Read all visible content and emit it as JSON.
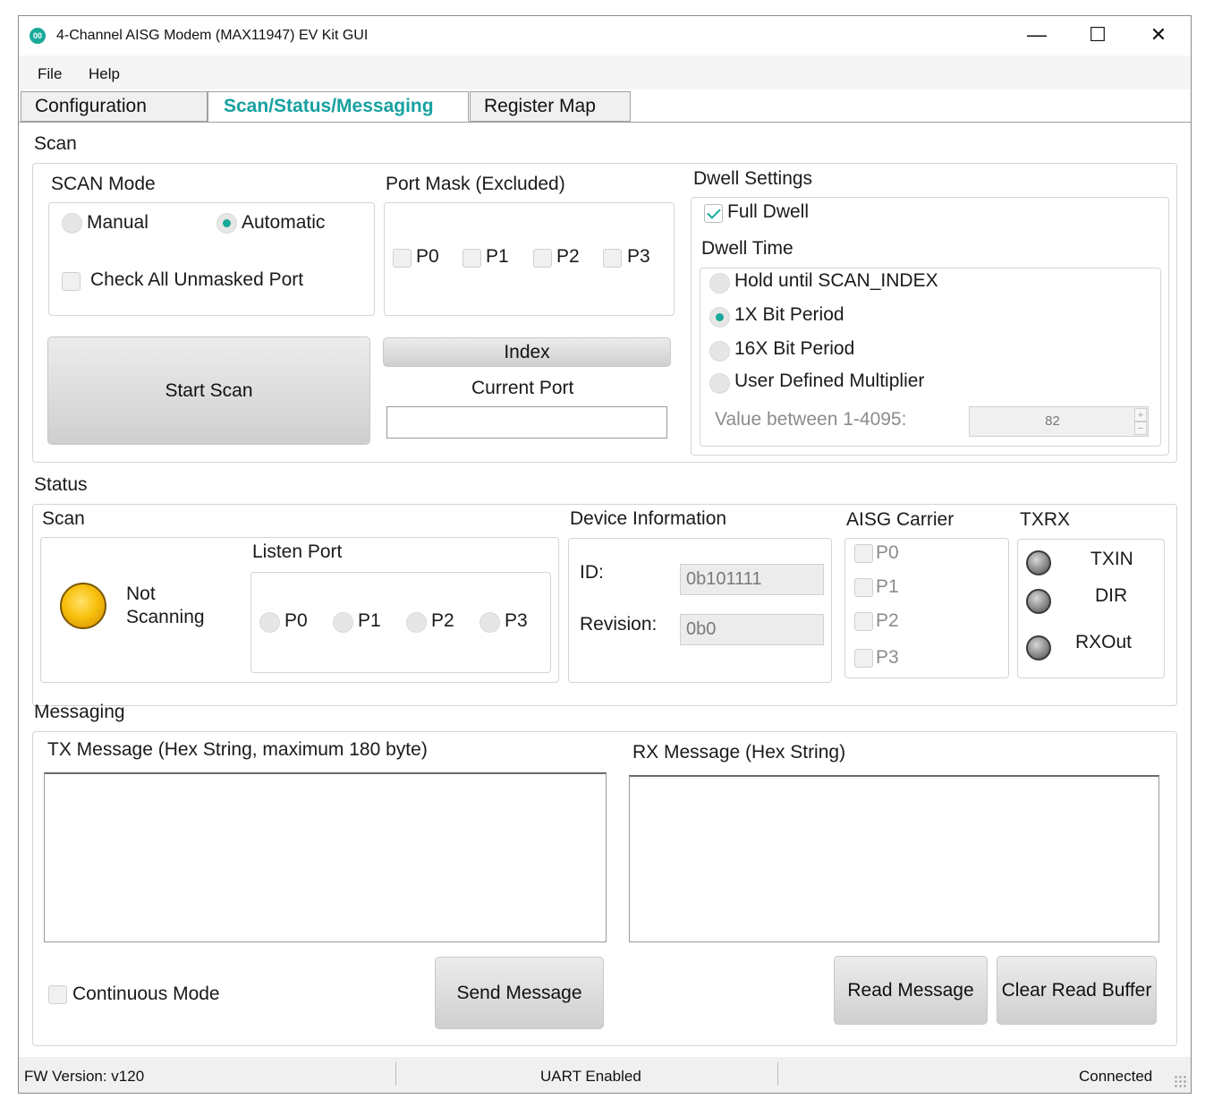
{
  "window": {
    "title": "4-Channel AISG Modem (MAX11947) EV Kit GUI",
    "icon_text": "00",
    "minimize_symbol": "—",
    "maximize_symbol": "☐",
    "close_symbol": "✕"
  },
  "menu": [
    "File",
    "Help"
  ],
  "tabs": [
    {
      "label": "Configuration",
      "active": false
    },
    {
      "label": "Scan/Status/Messaging",
      "active": true
    },
    {
      "label": "Register Map",
      "active": false
    }
  ],
  "scan": {
    "section_title": "Scan",
    "mode": {
      "title": "SCAN Mode",
      "options": [
        {
          "label": "Manual",
          "checked": false
        },
        {
          "label": "Automatic",
          "checked": true
        }
      ],
      "check_all_label": "Check All Unmasked Port"
    },
    "port_mask": {
      "title": "Port Mask (Excluded)",
      "ports": [
        "P0",
        "P1",
        "P2",
        "P3"
      ]
    },
    "start_button": "Start Scan",
    "index_button": "Index",
    "current_port_label": "Current Port",
    "current_port_value": "",
    "dwell": {
      "title": "Dwell Settings",
      "full_dwell_label": "Full Dwell",
      "full_dwell_checked": true,
      "dwell_time_title": "Dwell Time",
      "options": [
        {
          "label": "Hold until SCAN_INDEX",
          "checked": false
        },
        {
          "label": "1X Bit Period",
          "checked": true
        },
        {
          "label": "16X Bit Period",
          "checked": false
        },
        {
          "label": "User Defined Multiplier",
          "checked": false
        }
      ],
      "value_label": "Value between 1-4095:",
      "value": "82",
      "spin_up": "+",
      "spin_down": "−"
    }
  },
  "status": {
    "section_title": "Status",
    "scan_title": "Scan",
    "scan_state_line1": "Not",
    "scan_state_line2": "Scanning",
    "listen_port_title": "Listen Port",
    "listen_ports": [
      "P0",
      "P1",
      "P2",
      "P3"
    ],
    "device_info": {
      "title": "Device Information",
      "id_label": "ID:",
      "id_value": "0b101111",
      "revision_label": "Revision:",
      "revision_value": "0b0"
    },
    "aisg_carrier": {
      "title": "AISG Carrier",
      "ports": [
        "P0",
        "P1",
        "P2",
        "P3"
      ]
    },
    "txrx": {
      "title": "TXRX",
      "signals": [
        "TXIN",
        "DIR",
        "RXOut"
      ]
    }
  },
  "messaging": {
    "section_title": "Messaging",
    "tx_label": "TX Message (Hex String, maximum 180 byte)",
    "rx_label": "RX Message (Hex String)",
    "tx_value": "",
    "rx_value": "",
    "continuous_mode_label": "Continuous Mode",
    "send_button": "Send Message",
    "read_button": "Read Message",
    "clear_button": "Clear Read Buffer"
  },
  "statusbar": {
    "fw_version": "FW Version: v120",
    "uart": "UART Enabled",
    "connection": "Connected"
  },
  "colors": {
    "accent": "#18a999",
    "led_amber": "#f8c10f",
    "led_off": "#8a8a8a"
  }
}
